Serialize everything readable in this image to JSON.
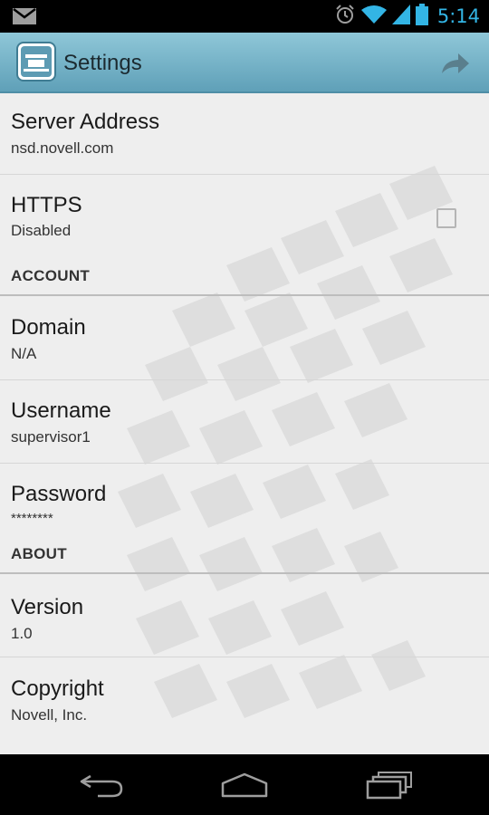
{
  "status_bar": {
    "time": "5:14",
    "icons": [
      "gmail-notification-icon",
      "alarm-icon",
      "wifi-icon",
      "cell-signal-icon",
      "battery-icon"
    ]
  },
  "action_bar": {
    "title": "Settings",
    "app_icon": "novell-app-icon",
    "share_icon": "share-icon",
    "background_color": "#6fb0c6"
  },
  "preferences": {
    "server_address": {
      "title": "Server Address",
      "summary": "nsd.novell.com"
    },
    "https": {
      "title": "HTTPS",
      "summary": "Disabled",
      "checked": false
    },
    "account_header": "ACCOUNT",
    "domain": {
      "title": "Domain",
      "summary": "N/A"
    },
    "username": {
      "title": "Username",
      "summary": "supervisor1"
    },
    "password": {
      "title": "Password",
      "summary": "********"
    },
    "about_header": "ABOUT",
    "version": {
      "title": "Version",
      "summary": "1.0"
    },
    "copyright": {
      "title": "Copyright",
      "summary": "Novell, Inc."
    }
  },
  "nav_bar": {
    "buttons": [
      "back-icon",
      "home-icon",
      "recent-apps-icon"
    ]
  }
}
